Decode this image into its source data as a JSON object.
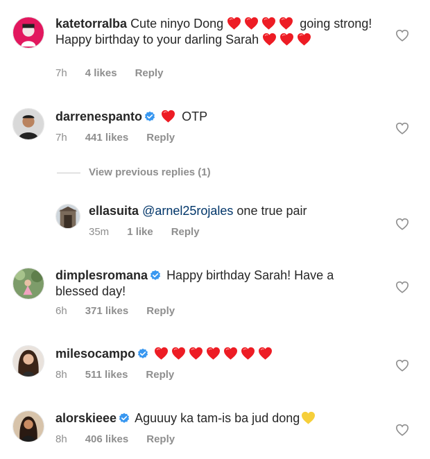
{
  "colors": {
    "heart": "#ed1c24",
    "verified": "#3897f0",
    "meta": "#8e8e8e",
    "mention": "#003569"
  },
  "comments": [
    {
      "user": "katetorralba",
      "text_before": "Cute ninyo Dong",
      "text_after": "going strong! Happy birthday to your darling Sarah",
      "time": "7h",
      "likes": "4 likes",
      "reply": "Reply"
    },
    {
      "user": "darrenespanto",
      "text": "OTP",
      "time": "7h",
      "likes": "441 likes",
      "reply": "Reply"
    },
    {
      "view_previous": "View previous replies (1)"
    },
    {
      "user": "ellasuita",
      "mention": "@arnel25rojales",
      "text": "one true pair",
      "time": "35m",
      "likes": "1 like",
      "reply": "Reply"
    },
    {
      "user": "dimplesromana",
      "text": "Happy birthday Sarah! Have a blessed day!",
      "time": "6h",
      "likes": "371 likes",
      "reply": "Reply"
    },
    {
      "user": "milesocampo",
      "text": "",
      "time": "8h",
      "likes": "511 likes",
      "reply": "Reply"
    },
    {
      "user": "alorskieee",
      "text": "Aguuuy ka tam-is ba jud dong",
      "time": "8h",
      "likes": "406 likes",
      "reply": "Reply"
    }
  ]
}
